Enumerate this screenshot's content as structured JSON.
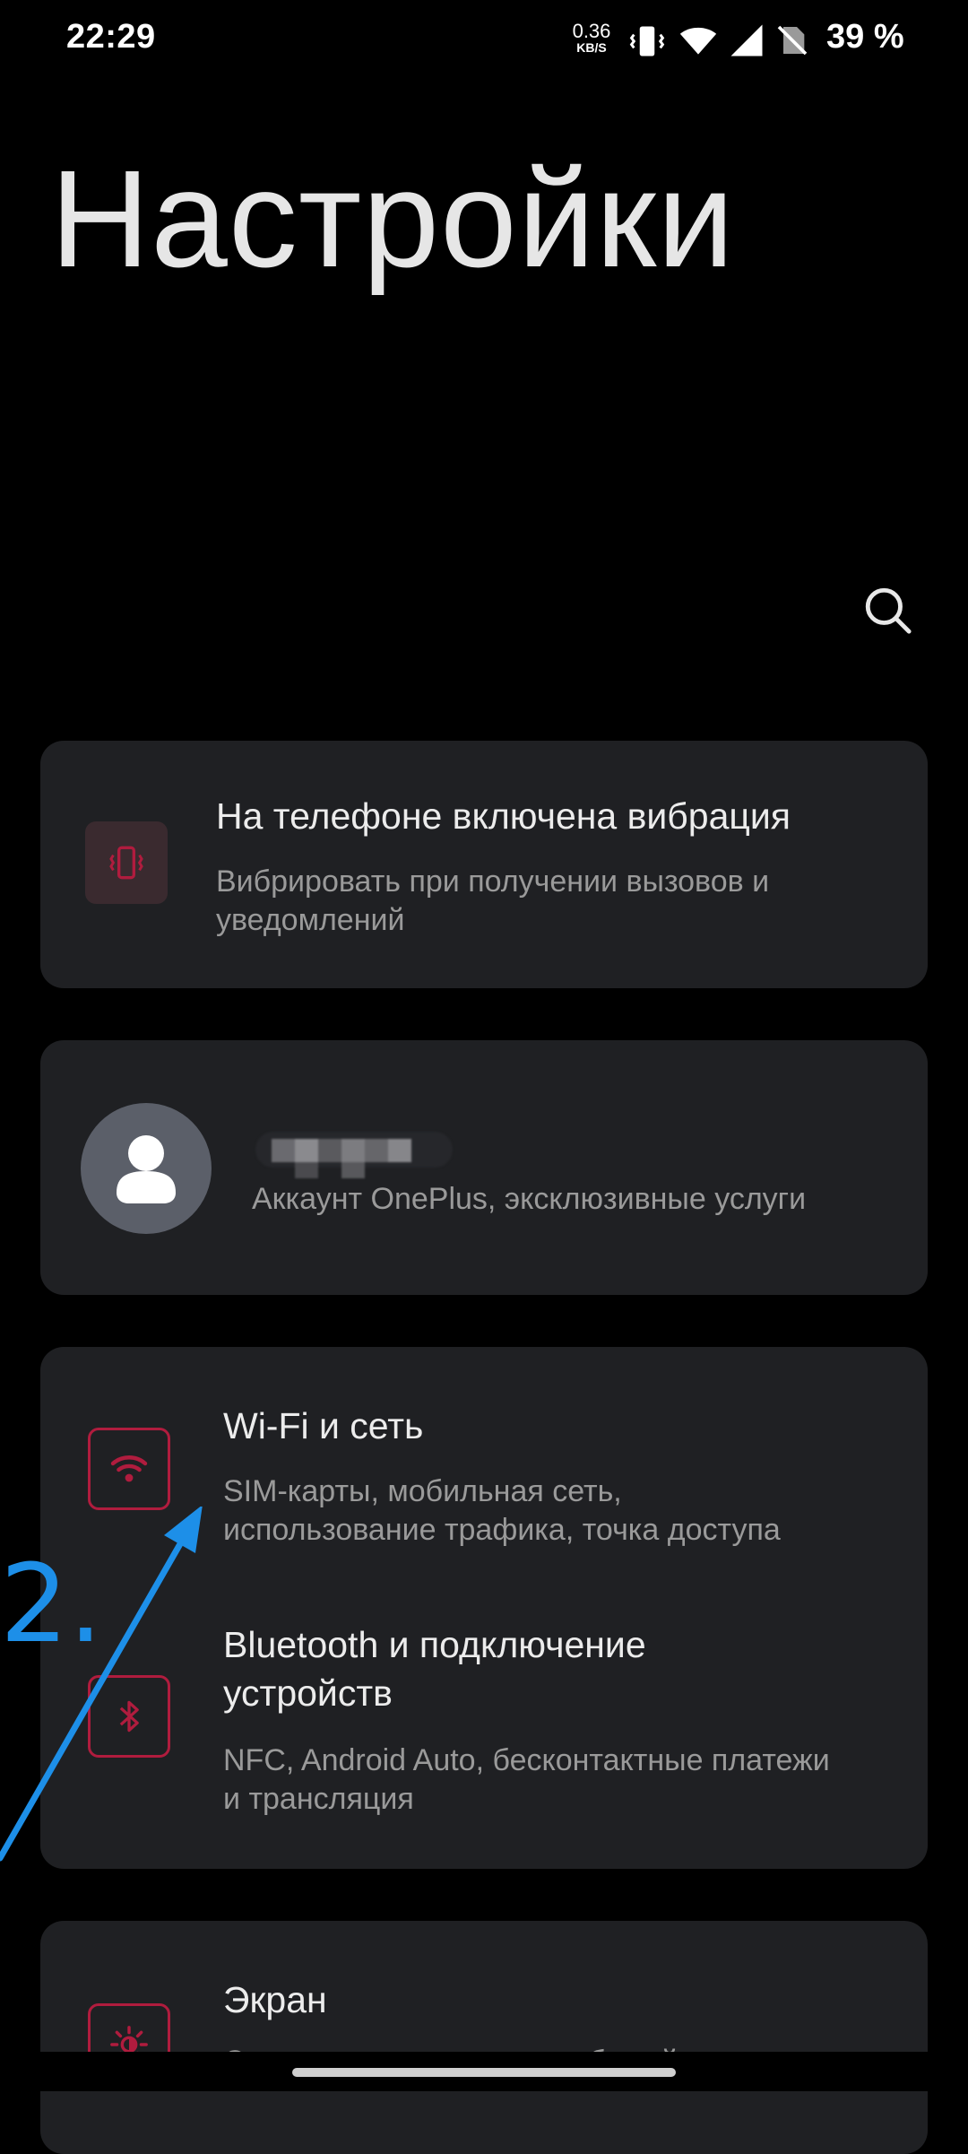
{
  "status_bar": {
    "time": "22:29",
    "net_speed_value": "0.36",
    "net_speed_unit": "KB/S",
    "battery": "39 %",
    "icons": [
      "vibrate-icon",
      "wifi-icon",
      "cell-signal-icon",
      "no-sim-icon"
    ]
  },
  "header": {
    "title": "Настройки",
    "search_icon": "search-icon"
  },
  "vibration_card": {
    "icon": "vibrate-icon",
    "title": "На телефоне включена вибрация",
    "subtitle_line1": "Вибрировать при получении вызовов и",
    "subtitle_line2": "уведомлений"
  },
  "account_card": {
    "avatar_icon": "person-icon",
    "subtitle": "Аккаунт OnePlus, эксклюзивные услуги"
  },
  "network_card": {
    "wifi_item": {
      "icon": "wifi-icon",
      "title": "Wi-Fi и сеть",
      "subtitle_line1": "SIM-карты, мобильная сеть,",
      "subtitle_line2": "использование трафика, точка доступа"
    },
    "bluetooth_item": {
      "icon": "bluetooth-icon",
      "title_line1": "Bluetooth и подключение",
      "title_line2": "устройств",
      "subtitle_line1": "NFC, Android Auto, бесконтактные платежи",
      "subtitle_line2": "и трансляция"
    }
  },
  "screen_card": {
    "icon": "brightness-icon",
    "title": "Экран",
    "subtitle_line1": "Строка состояния, черно-белый экран"
  },
  "annotation": {
    "label": "2.",
    "color": "#1d8fe8"
  },
  "colors": {
    "accent": "#b01c3e",
    "card_bg": "#1f2023",
    "background": "#000000"
  }
}
